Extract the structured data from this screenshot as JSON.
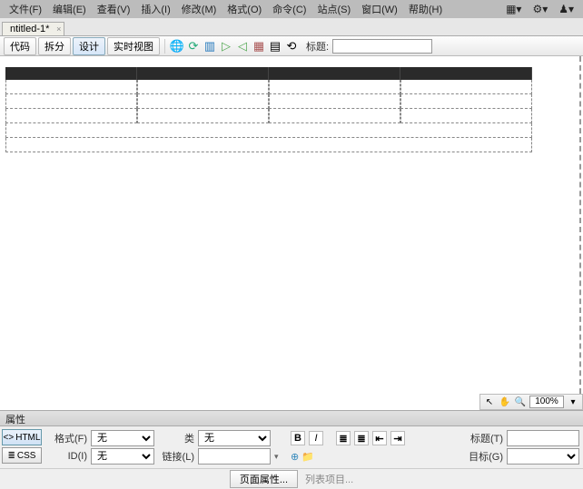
{
  "menu": {
    "items": [
      "文件(F)",
      "编辑(E)",
      "查看(V)",
      "插入(I)",
      "修改(M)",
      "格式(O)",
      "命令(C)",
      "站点(S)",
      "窗口(W)",
      "帮助(H)"
    ],
    "right_icons": [
      "layout-icon",
      "gear-icon",
      "user-icon"
    ]
  },
  "tab": {
    "name": "ntitled-1*",
    "close": "×"
  },
  "toolbar": {
    "views": [
      "代码",
      "拆分",
      "设计",
      "实时视图"
    ],
    "active_view": 2,
    "icons": [
      "globe-icon",
      "refresh-arrows-icon",
      "page-icon",
      "play-right-icon",
      "play-left-icon",
      "inspect-icon",
      "grid-icon",
      "refresh-icon"
    ],
    "title_label": "标题:",
    "title_value": ""
  },
  "document": {
    "table": {
      "cols": 4,
      "dashed_rows": 3,
      "full_rows": 2
    }
  },
  "zoombar": {
    "icons": [
      "pointer-icon",
      "hand-icon",
      "zoom-icon"
    ],
    "value": "100%"
  },
  "panel_header": "属性",
  "props": {
    "modes": [
      {
        "label": "HTML",
        "icon": "<>"
      },
      {
        "label": "CSS",
        "icon": "≣"
      }
    ],
    "active_mode": 0,
    "format_label": "格式(F)",
    "format_value": "无",
    "class_label": "类",
    "class_value": "无",
    "id_label": "ID(I)",
    "id_value": "无",
    "link_label": "链接(L)",
    "link_value": "",
    "title_label": "标题(T)",
    "title_value": "",
    "target_label": "目标(G)",
    "target_value": "",
    "fmt_buttons": [
      "B",
      "I"
    ],
    "list_buttons": [
      "ul-icon",
      "ol-icon",
      "outdent-icon",
      "indent-icon"
    ]
  },
  "bottom": {
    "page_props": "页面属性...",
    "list_item": "列表项目..."
  }
}
